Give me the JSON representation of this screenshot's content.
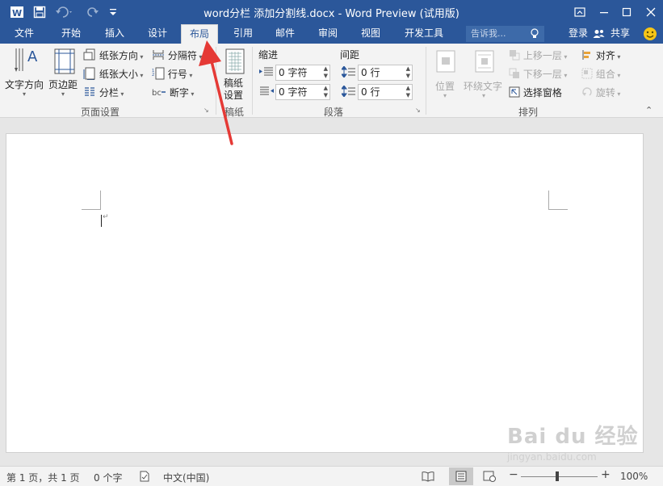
{
  "titlebar": {
    "title": "word分栏 添加分割线.docx - Word Preview (试用版)",
    "app_icon": "word-logo-icon",
    "quick_access": [
      "save-icon",
      "undo-icon",
      "redo-icon",
      "customize-icon"
    ]
  },
  "tabs": [
    "文件",
    "开始",
    "插入",
    "设计",
    "布局",
    "引用",
    "邮件",
    "审阅",
    "视图",
    "开发工具"
  ],
  "active_tab": "布局",
  "tellme": {
    "placeholder": "告诉我..."
  },
  "account": {
    "signin": "登录",
    "share": "共享"
  },
  "ribbon": {
    "page_setup": {
      "label": "页面设置",
      "text_direction": "文字方向",
      "margins": "页边距",
      "orientation": "纸张方向",
      "size": "纸张大小",
      "columns": "分栏",
      "breaks": "分隔符",
      "line_numbers": "行号",
      "hyphenation": "断字"
    },
    "manuscript": {
      "label": "稿纸",
      "button_line1": "稿纸",
      "button_line2": "设置"
    },
    "paragraph": {
      "label": "段落",
      "indent_title": "缩进",
      "spacing_title": "间距",
      "indent_left": "0 字符",
      "indent_right": "0 字符",
      "spacing_before": "0 行",
      "spacing_after": "0 行"
    },
    "arrange": {
      "label": "排列",
      "position": "位置",
      "wrap_text": "环绕文字",
      "bring_forward": "上移一层",
      "send_backward": "下移一层",
      "selection_pane": "选择窗格",
      "align": "对齐",
      "group": "组合",
      "rotate": "旋转"
    }
  },
  "status": {
    "page": "第 1 页，共 1 页",
    "words": "0 个字",
    "language": "中文(中国)",
    "zoom": "100%"
  },
  "watermark": {
    "line1": "Bai du 经验",
    "line2": "jingyan.baidu.com"
  }
}
